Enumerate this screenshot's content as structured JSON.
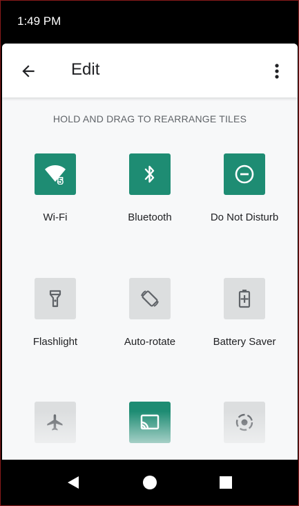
{
  "status_bar": {
    "time": "1:49 PM"
  },
  "app_bar": {
    "title": "Edit"
  },
  "hint": "HOLD AND DRAG TO REARRANGE TILES",
  "tiles": [
    {
      "label": "Wi-Fi",
      "icon": "wifi-icon",
      "state": "active",
      "badge": "5"
    },
    {
      "label": "Bluetooth",
      "icon": "bluetooth-icon",
      "state": "active"
    },
    {
      "label": "Do Not Disturb",
      "icon": "do-not-disturb-icon",
      "state": "active"
    },
    {
      "label": "Flashlight",
      "icon": "flashlight-icon",
      "state": "inactive"
    },
    {
      "label": "Auto-rotate",
      "icon": "auto-rotate-icon",
      "state": "inactive"
    },
    {
      "label": "Battery Saver",
      "icon": "battery-saver-icon",
      "state": "inactive"
    },
    {
      "label": "",
      "icon": "airplane-icon",
      "state": "inactive"
    },
    {
      "label": "",
      "icon": "cast-icon",
      "state": "active"
    },
    {
      "label": "",
      "icon": "screen-record-icon",
      "state": "inactive"
    }
  ],
  "colors": {
    "active_tile": "#1e8c73",
    "inactive_tile": "#dcdedf",
    "inactive_glyph": "#5f6368"
  }
}
